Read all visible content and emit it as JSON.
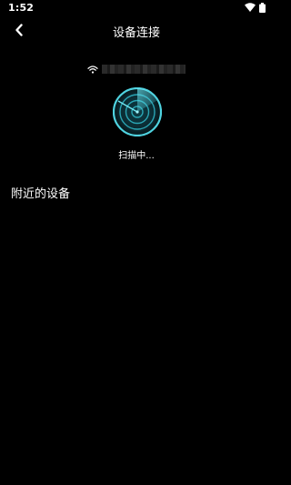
{
  "status_bar": {
    "time": "1:52",
    "icons": [
      "wifi-icon",
      "battery-icon"
    ]
  },
  "header": {
    "title": "设备连接",
    "back_icon": "chevron-left-icon"
  },
  "wifi": {
    "icon": "wifi-icon",
    "network_name": "",
    "name_obscured": true
  },
  "scan": {
    "icon": "radar-icon",
    "status_text": "扫描中..."
  },
  "nearby": {
    "section_title": "附近的设备",
    "devices": []
  },
  "colors": {
    "background": "#000000",
    "text": "#ffffff",
    "accent": "#3ec5d4"
  }
}
